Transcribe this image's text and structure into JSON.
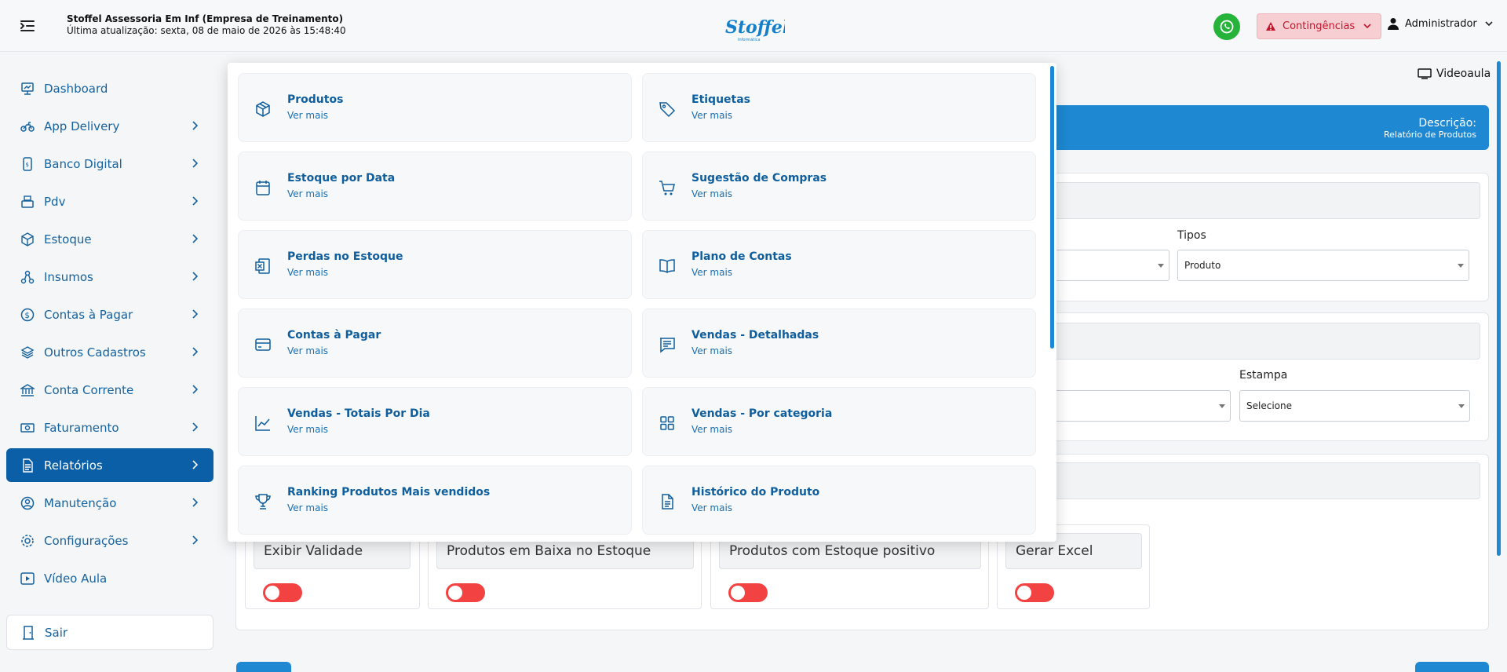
{
  "header": {
    "company": "Stoffel Assessoria Em Inf (Empresa de Treinamento)",
    "last_update": "Última atualização: sexta, 08 de maio de 2026 às 15:48:40",
    "logo_text": "Stoffel",
    "contingencia_label": "Contingências",
    "user_label": "Administrador"
  },
  "sidebar": {
    "items": [
      {
        "label": "Dashboard",
        "icon": "dashboard-icon",
        "arrow": false
      },
      {
        "label": "App Delivery",
        "icon": "motorcycle-icon",
        "arrow": true
      },
      {
        "label": "Banco Digital",
        "icon": "bank-phone-icon",
        "arrow": true
      },
      {
        "label": "Pdv",
        "icon": "register-icon",
        "arrow": true
      },
      {
        "label": "Estoque",
        "icon": "box-icon",
        "arrow": true
      },
      {
        "label": "Insumos",
        "icon": "network-icon",
        "arrow": true
      },
      {
        "label": "Contas à Pagar",
        "icon": "dollar-circle-icon",
        "arrow": true
      },
      {
        "label": "Outros Cadastros",
        "icon": "layers-icon",
        "arrow": true
      },
      {
        "label": "Conta Corrente",
        "icon": "bank-icon",
        "arrow": true
      },
      {
        "label": "Faturamento",
        "icon": "money-icon",
        "arrow": true
      },
      {
        "label": "Relatórios",
        "icon": "report-icon",
        "arrow": true,
        "active": true
      },
      {
        "label": "Manutenção",
        "icon": "user-gear-icon",
        "arrow": true
      },
      {
        "label": "Configurações",
        "icon": "gear-icon",
        "arrow": true
      },
      {
        "label": "Vídeo Aula",
        "icon": "video-icon",
        "arrow": false
      }
    ],
    "sair_label": "Sair"
  },
  "main": {
    "videoaula_label": "Videoaula",
    "desc_title": "Descrição:",
    "desc_subtitle": "Relatório de Produtos",
    "tipos_label": "Tipos",
    "tipos_value": "Produto",
    "estampa_label": "Estampa",
    "estampa_value": "Selecione",
    "switches": [
      {
        "label": "Exibir Validade"
      },
      {
        "label": "Produtos em Baixa no Estoque"
      },
      {
        "label": "Produtos com Estoque positivo"
      },
      {
        "label": "Gerar Excel"
      }
    ]
  },
  "reports_menu": {
    "cards": [
      {
        "title": "Produtos",
        "sub": "Ver mais",
        "icon": "box-icon"
      },
      {
        "title": "Etiquetas",
        "sub": "Ver mais",
        "icon": "tag-icon"
      },
      {
        "title": "Estoque por Data",
        "sub": "Ver mais",
        "icon": "calendar-icon"
      },
      {
        "title": "Sugestão de Compras",
        "sub": "Ver mais",
        "icon": "cart-icon"
      },
      {
        "title": "Perdas no Estoque",
        "sub": "Ver mais",
        "icon": "excel-icon"
      },
      {
        "title": "Plano de Contas",
        "sub": "Ver mais",
        "icon": "book-icon"
      },
      {
        "title": "Contas à Pagar",
        "sub": "Ver mais",
        "icon": "card-icon"
      },
      {
        "title": "Vendas - Detalhadas",
        "sub": "Ver mais",
        "icon": "message-icon"
      },
      {
        "title": "Vendas - Totais Por Dia",
        "sub": "Ver mais",
        "icon": "chart-line-icon"
      },
      {
        "title": "Vendas - Por categoria",
        "sub": "Ver mais",
        "icon": "grid-icon"
      },
      {
        "title": "Ranking Produtos Mais vendidos",
        "sub": "Ver mais",
        "icon": "trophy-icon"
      },
      {
        "title": "Histórico do Produto",
        "sub": "Ver mais",
        "icon": "document-icon"
      }
    ]
  },
  "colors": {
    "primary": "#0a5fa7",
    "accent": "#1e88d2",
    "danger": "#f34242",
    "whatsapp": "#25b33a"
  }
}
